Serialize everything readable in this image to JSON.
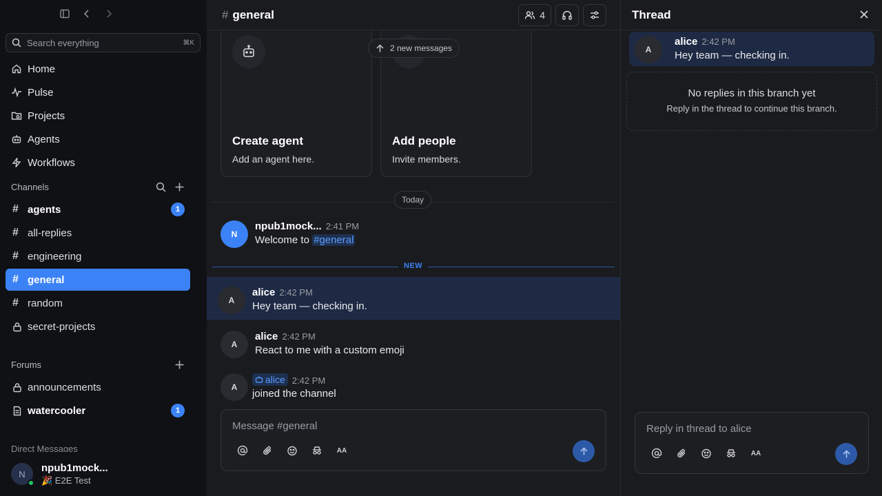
{
  "sidebar": {
    "search_placeholder": "Search everything",
    "search_shortcut": "⌘K",
    "nav": [
      {
        "label": "Home",
        "icon": "home-icon"
      },
      {
        "label": "Pulse",
        "icon": "pulse-icon"
      },
      {
        "label": "Projects",
        "icon": "projects-icon"
      },
      {
        "label": "Agents",
        "icon": "agents-icon"
      },
      {
        "label": "Workflows",
        "icon": "workflows-icon"
      }
    ],
    "channels_label": "Channels",
    "channels": [
      {
        "name": "agents",
        "badge": "1"
      },
      {
        "name": "all-replies"
      },
      {
        "name": "engineering"
      },
      {
        "name": "general"
      },
      {
        "name": "random"
      },
      {
        "name": "secret-projects"
      }
    ],
    "forums_label": "Forums",
    "forums": [
      {
        "name": "announcements"
      },
      {
        "name": "watercooler",
        "badge": "1"
      }
    ],
    "dm_label": "Direct Messages",
    "user": {
      "initial": "N",
      "name": "npub1mock...",
      "status": "🎉 E2E Test"
    }
  },
  "main": {
    "channel_title": "general",
    "member_count": "4",
    "cards": [
      {
        "title": "Create agent",
        "subtitle": "Add an agent here."
      },
      {
        "title": "Add people",
        "subtitle": "Invite members."
      }
    ],
    "new_messages_pill": "2 new messages",
    "today_label": "Today",
    "new_label": "NEW",
    "messages": [
      {
        "initial": "N",
        "author": "npub1mock...",
        "time": "2:41 PM",
        "text": "Welcome to ",
        "mention": "#general"
      },
      {
        "initial": "A",
        "author": "alice",
        "time": "2:42 PM",
        "text": "Hey team — checking in."
      },
      {
        "initial": "A",
        "author": "alice",
        "time": "2:42 PM",
        "text": "React to me with a custom emoji"
      },
      {
        "initial": "A",
        "author": "alice",
        "time": "2:42 PM",
        "text": "joined the channel"
      }
    ],
    "composer_placeholder": "Message #general",
    "format_label": "AA"
  },
  "thread": {
    "title": "Thread",
    "parent": {
      "initial": "A",
      "author": "alice",
      "time": "2:42 PM",
      "text": "Hey team — checking in."
    },
    "empty_title": "No replies in this branch yet",
    "empty_subtitle": "Reply in the thread to continue this branch.",
    "composer_placeholder": "Reply in thread to alice",
    "format_label": "AA"
  },
  "colors": {
    "accent": "#3b82f6",
    "highlight": "#1e2a44",
    "online": "#22c55e"
  }
}
